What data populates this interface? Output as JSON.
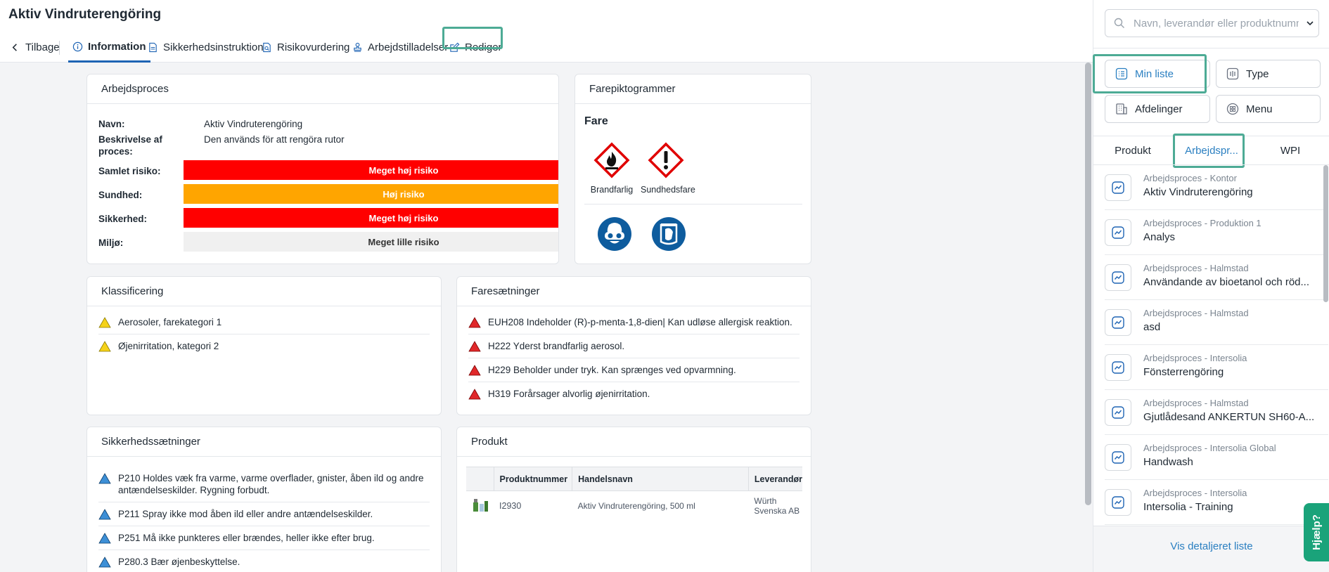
{
  "page_title": "Aktiv Vindruterengöring",
  "tabs": [
    {
      "label": "Tilbage",
      "icon": "chevron-left-icon"
    },
    {
      "label": "Information",
      "icon": "info-icon"
    },
    {
      "label": "Sikkerhedsinstruktion",
      "icon": "document-icon"
    },
    {
      "label": "Risikovurdering",
      "icon": "document-search-icon"
    },
    {
      "label": "Arbejdstilladelser",
      "icon": "stamp-icon"
    },
    {
      "label": "Rediger",
      "icon": "edit-icon"
    }
  ],
  "arbejdsproces": {
    "title": "Arbejdsproces",
    "navn_label": "Navn:",
    "navn_value": "Aktiv Vindruterengöring",
    "beskrivelse_label": "Beskrivelse af proces:",
    "beskrivelse_value": "Den används för att rengöra rutor",
    "risks": [
      {
        "label": "Samlet risiko:",
        "value": "Meget høj risiko",
        "color": "#ff0000",
        "text_color": "#ffffff"
      },
      {
        "label": "Sundhed:",
        "value": "Høj risiko",
        "color": "#ffa500",
        "text_color": "#ffffff"
      },
      {
        "label": "Sikkerhed:",
        "value": "Meget høj risiko",
        "color": "#ff0000",
        "text_color": "#ffffff"
      },
      {
        "label": "Miljø:",
        "value": "Meget lille risiko",
        "color": "#f0f0f0",
        "text_color": "#333333"
      }
    ]
  },
  "farepiktogrammer": {
    "title": "Farepiktogrammer",
    "signal_word": "Fare",
    "pictograms": [
      {
        "label": "Brandfarlig",
        "icon": "flame-pictogram-icon"
      },
      {
        "label": "Sundhedsfare",
        "icon": "exclamation-pictogram-icon"
      }
    ],
    "ppe": [
      {
        "icon": "safety-goggles-icon"
      },
      {
        "icon": "face-shield-icon"
      }
    ]
  },
  "klassificering": {
    "title": "Klassificering",
    "items": [
      "Aerosoler, farekategori 1",
      "Øjenirritation, kategori 2"
    ]
  },
  "faresaetninger": {
    "title": "Faresætninger",
    "items": [
      "EUH208 Indeholder (R)-p-menta-1,8-dien| Kan udløse allergisk reaktion.",
      "H222 Yderst brandfarlig aerosol.",
      "H229 Beholder under tryk. Kan sprænges ved opvarmning.",
      "H319 Forårsager alvorlig øjenirritation."
    ]
  },
  "sikkerhedssaetninger": {
    "title": "Sikkerhedssætninger",
    "items": [
      "P210 Holdes væk fra varme, varme overflader, gnister, åben ild og andre antændelseskilder. Rygning forbudt.",
      "P211 Spray ikke mod åben ild eller andre antændelseskilder.",
      "P251 Må ikke punkteres eller brændes, heller ikke efter brug.",
      "P280.3 Bær øjenbeskyttelse."
    ]
  },
  "produkt": {
    "title": "Produkt",
    "columns": [
      "Produktnummer",
      "Handelsnavn",
      "Leverandør"
    ],
    "rows": [
      {
        "produktnummer": "I2930",
        "handelsnavn": "Aktiv Vindruterengöring, 500 ml",
        "leverandor": "Würth Svenska AB"
      }
    ]
  },
  "sidebar": {
    "search_placeholder": "Navn, leverandør eller produktnummer",
    "filters": [
      {
        "label": "Min liste",
        "icon": "list-icon"
      },
      {
        "label": "Type",
        "icon": "type-icon"
      },
      {
        "label": "Afdelinger",
        "icon": "building-icon"
      },
      {
        "label": "Menu",
        "icon": "grid-icon"
      }
    ],
    "tabs": [
      "Produkt",
      "Arbejdspr...",
      "WPI"
    ],
    "items": [
      {
        "sub": "Arbejdsproces - Kontor",
        "name": "Aktiv Vindruterengöring"
      },
      {
        "sub": "Arbejdsproces - Produktion 1",
        "name": "Analys"
      },
      {
        "sub": "Arbejdsproces - Halmstad",
        "name": "Användande av bioetanol och röd..."
      },
      {
        "sub": "Arbejdsproces - Halmstad",
        "name": "asd"
      },
      {
        "sub": "Arbejdsproces - Intersolia",
        "name": "Fönsterrengöring"
      },
      {
        "sub": "Arbejdsproces - Halmstad",
        "name": "Gjutlådesand ANKERTUN SH60-A..."
      },
      {
        "sub": "Arbejdsproces - Intersolia Global",
        "name": "Handwash"
      },
      {
        "sub": "Arbejdsproces - Intersolia",
        "name": "Intersolia - Training"
      }
    ],
    "footer_link": "Vis detaljeret liste",
    "help_label": "Hjælp?"
  },
  "colors": {
    "accent": "#1e64b4",
    "highlight": "#4dab95",
    "sidebar_accent": "#2a7fc1",
    "help_bg": "#1aa37a"
  }
}
